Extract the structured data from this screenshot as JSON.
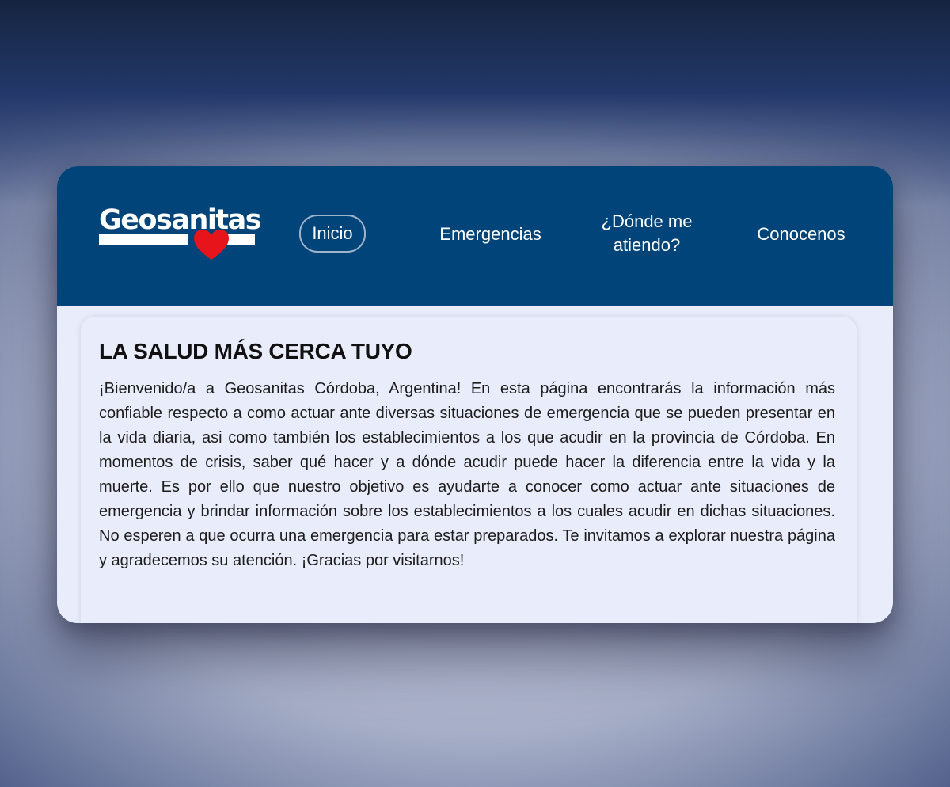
{
  "logo": {
    "text": "Geosanitas",
    "heart_color": "#e8141c"
  },
  "nav": {
    "items": [
      {
        "label": "Inicio",
        "active": true
      },
      {
        "label": "Emergencias",
        "active": false
      },
      {
        "label": "¿Dónde me atiendo?",
        "active": false
      },
      {
        "label": "Conocenos",
        "active": false
      }
    ]
  },
  "main": {
    "title": "LA SALUD MÁS CERCA TUYO",
    "paragraph": "¡Bienvenido/a a Geosanitas Córdoba, Argentina! En esta página encontrarás la información más confiable respecto a como actuar ante diversas situaciones de emergencia que se pueden presentar en la vida diaria, asi como también los establecimientos a los que acudir en la provincia de Córdoba. En momentos de crisis, saber qué hacer y a dónde acudir puede hacer la diferencia entre la vida y la muerte. Es por ello que nuestro objetivo es ayudarte a conocer como actuar ante situaciones de emergencia y brindar información sobre los establecimientos a los cuales acudir en dichas situaciones. No esperen a que ocurra una emergencia para estar preparados. Te invitamos a explorar nuestra página y agradecemos su atención. ¡Gracias por visitarnos!"
  },
  "colors": {
    "header": "#004479",
    "content_background": "#e9edfb",
    "nav_text": "#ffffff",
    "active_border": "#9fb3cc"
  }
}
